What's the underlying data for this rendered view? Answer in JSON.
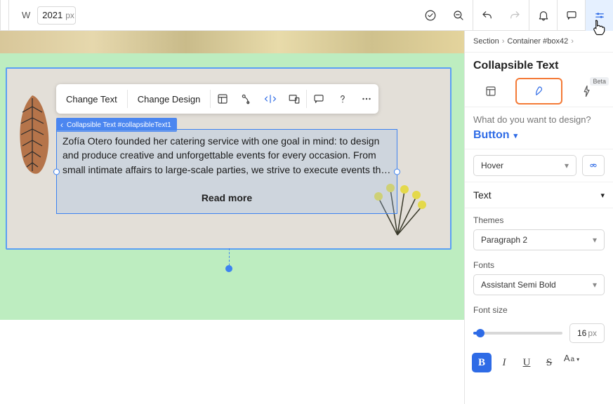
{
  "topbar": {
    "width_label": "W",
    "width_value": "2021",
    "width_unit": "px"
  },
  "canvas": {
    "toolbar": {
      "change_text": "Change Text",
      "change_design": "Change Design"
    },
    "selection_tag": "Collapsible Text #collapsibleText1",
    "body_text": "Zofía Otero founded her catering service with one goal in mind: to design and produce creative and unforgettable events for every occasion. From small intimate affairs to large-scale parties, we strive to execute events th…",
    "read_more": "Read more"
  },
  "panel": {
    "breadcrumb": {
      "a": "Section",
      "b": "Container #box42"
    },
    "title": "Collapsible Text",
    "beta": "Beta",
    "design_q": "What do you want to design?",
    "design_target": "Button",
    "state": "Hover",
    "acc_text": "Text",
    "themes_label": "Themes",
    "theme_value": "Paragraph 2",
    "fonts_label": "Fonts",
    "font_value": "Assistant Semi Bold",
    "fontsize_label": "Font size",
    "fontsize_value": "16",
    "fontsize_unit": "px",
    "fmt": {
      "bold": "B",
      "italic": "I",
      "underline": "U",
      "strike": "S",
      "case": "Aa"
    }
  }
}
